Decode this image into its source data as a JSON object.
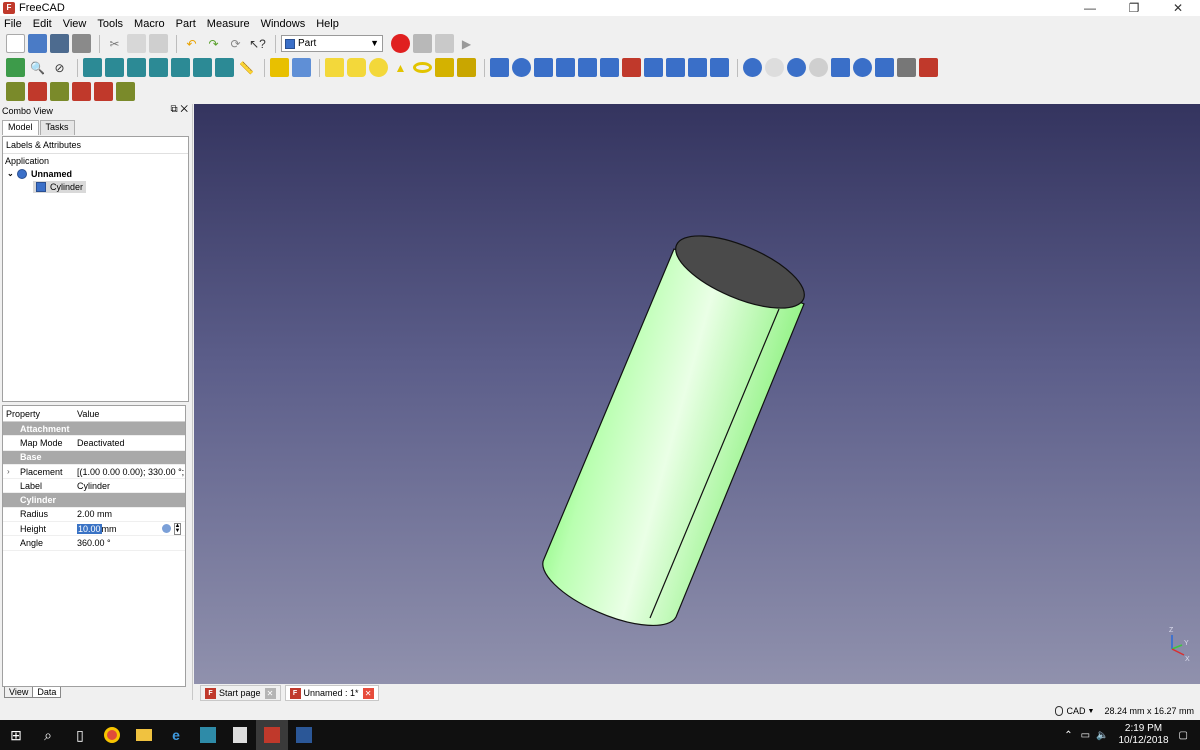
{
  "window": {
    "title": "FreeCAD",
    "controls": [
      "—",
      "❐",
      "✕"
    ]
  },
  "menu": [
    "File",
    "Edit",
    "View",
    "Tools",
    "Macro",
    "Part",
    "Measure",
    "Windows",
    "Help"
  ],
  "workbench": {
    "selected": "Part"
  },
  "combo_view": {
    "title": "Combo View",
    "tabs": [
      "Model",
      "Tasks"
    ],
    "tree_header": "Labels & Attributes",
    "tree": {
      "root": "Application",
      "document": "Unnamed",
      "object": "Cylinder"
    }
  },
  "property_table": {
    "headers": [
      "Property",
      "Value"
    ],
    "groups": [
      {
        "name": "Attachment",
        "rows": [
          {
            "key": "Map Mode",
            "value": "Deactivated"
          }
        ]
      },
      {
        "name": "Base",
        "rows": [
          {
            "key": "Placement",
            "value": "[(1.00 0.00 0.00); 330.00 °; (..."
          },
          {
            "key": "Label",
            "value": "Cylinder"
          }
        ]
      },
      {
        "name": "Cylinder",
        "rows": [
          {
            "key": "Radius",
            "value": "2.00 mm"
          },
          {
            "key": "Height",
            "value_selected": "10.00",
            "value_unit": "mm"
          },
          {
            "key": "Angle",
            "value": "360.00 °"
          }
        ]
      }
    ],
    "bottom_tabs": [
      "View",
      "Data"
    ]
  },
  "doc_tabs": [
    "Start page",
    "Unnamed : 1*"
  ],
  "status": {
    "nav_style": "CAD",
    "dimensions": "28.24 mm x 16.27 mm"
  },
  "taskbar": {
    "time": "2:19 PM",
    "date": "10/12/2018"
  },
  "colors": {
    "cylinder": "#5cf24c",
    "viewport_top": "#34345f",
    "viewport_bottom": "#9091ad"
  },
  "axis_labels": {
    "z": "Z",
    "y": "Y",
    "x": "X"
  }
}
